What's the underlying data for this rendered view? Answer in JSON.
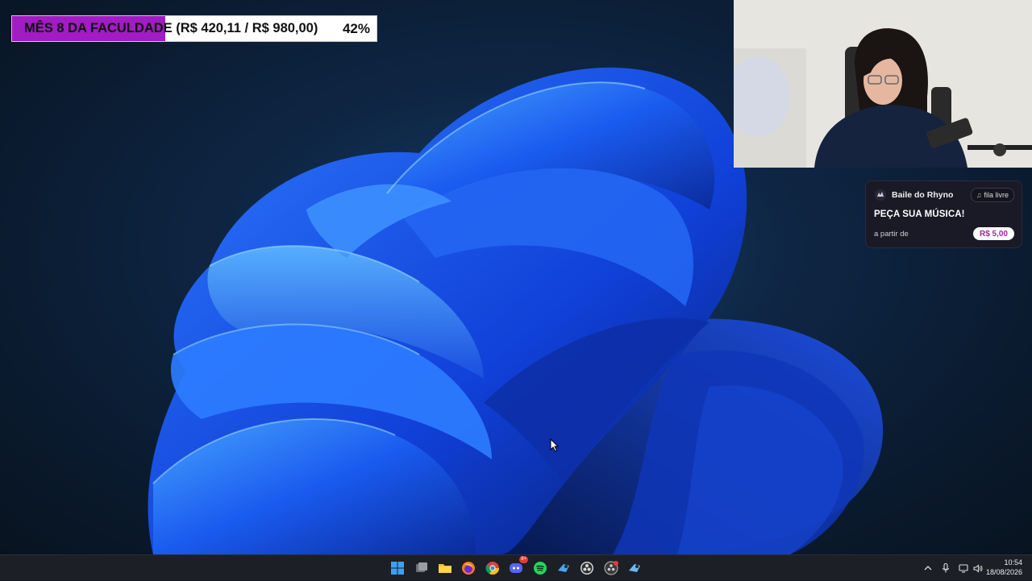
{
  "goal": {
    "title": "MÊS 8 DA FACULDADE (R$ 420,11 / R$ 980,00)",
    "percent_label": "42%",
    "progress": 0.42,
    "fill_color": "#a11cc2"
  },
  "music_card": {
    "logo_icon": "rhyno-logo-icon",
    "name": "Baile do Rhyno",
    "badge_icon": "music-note-icon",
    "badge_label": "fila livre",
    "title": "PEÇA SUA MÚSICA!",
    "subtitle": "a partir de",
    "price": "R$ 5,00",
    "accent_color": "#a3259c"
  },
  "taskbar": {
    "apps": [
      {
        "name": "start-button",
        "icon": "windows-logo-icon"
      },
      {
        "name": "task-view",
        "icon": "task-view-icon"
      },
      {
        "name": "file-explorer",
        "icon": "folder-icon"
      },
      {
        "name": "firefox",
        "icon": "firefox-icon"
      },
      {
        "name": "chrome",
        "icon": "chrome-icon"
      },
      {
        "name": "discord",
        "icon": "discord-icon",
        "badge": "9+"
      },
      {
        "name": "spotify",
        "icon": "spotify-icon"
      },
      {
        "name": "steam",
        "icon": "steam-icon"
      },
      {
        "name": "obs",
        "icon": "obs-icon"
      },
      {
        "name": "obs-2",
        "icon": "obs-recording-icon"
      },
      {
        "name": "steam-2",
        "icon": "steam-icon"
      }
    ],
    "tray": {
      "chevron_icon": "chevron-up-icon",
      "mic_icon": "microphone-icon",
      "network_icon": "network-icon",
      "volume_icon": "volume-icon"
    },
    "time": "10:54",
    "date": "18/08/2026"
  }
}
